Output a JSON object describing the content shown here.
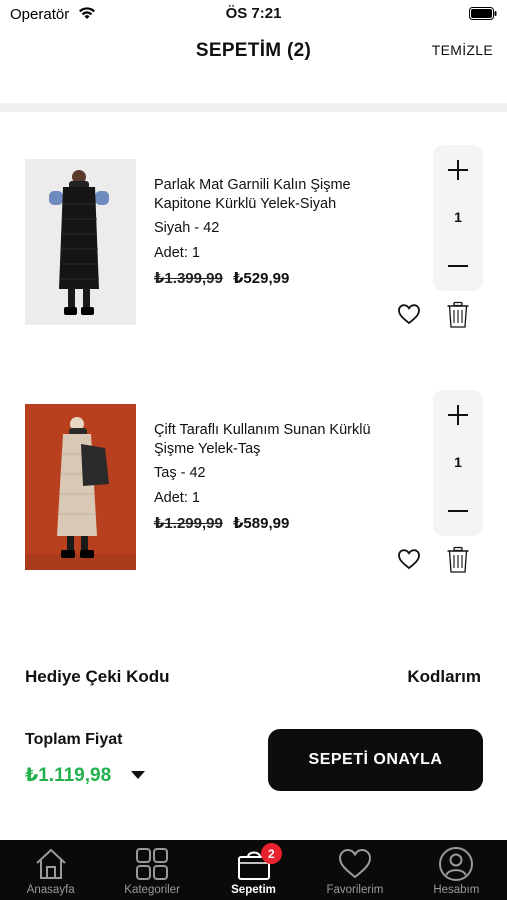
{
  "status_bar": {
    "carrier": "Operatör",
    "time": "ÖS 7:21"
  },
  "header": {
    "title": "SEPETİM (2)",
    "clear_label": "TEMİZLE"
  },
  "cart_items": [
    {
      "name": "Parlak Mat Garnili Kalın Şişme Kapitone Kürklü Yelek-Siyah",
      "variant": "Siyah - 42",
      "quantity_label": "Adet: 1",
      "old_price": "₺1.399,99",
      "new_price": "₺529,99",
      "stepper_value": "1",
      "image_bg": "#e9e9e9"
    },
    {
      "name": "Çift Taraflı Kullanım Sunan Kürklü Şişme Yelek-Taş",
      "variant": "Taş - 42",
      "quantity_label": "Adet: 1",
      "old_price": "₺1.299,99",
      "new_price": "₺589,99",
      "stepper_value": "1",
      "image_bg": "#b8401f"
    }
  ],
  "gift": {
    "label": "Hediye Çeki Kodu",
    "codes_link": "Kodlarım"
  },
  "total": {
    "label": "Toplam Fiyat",
    "value": "₺1.119,98",
    "value_color": "#22b14c"
  },
  "confirm_button": "SEPETİ ONAYLA",
  "tabs": [
    {
      "label": "Anasayfa",
      "icon": "home-icon"
    },
    {
      "label": "Kategoriler",
      "icon": "grid-icon"
    },
    {
      "label": "Sepetim",
      "icon": "bag-icon",
      "badge": "2",
      "active": true
    },
    {
      "label": "Favorilerim",
      "icon": "heart-icon"
    },
    {
      "label": "Hesabım",
      "icon": "user-icon"
    }
  ]
}
